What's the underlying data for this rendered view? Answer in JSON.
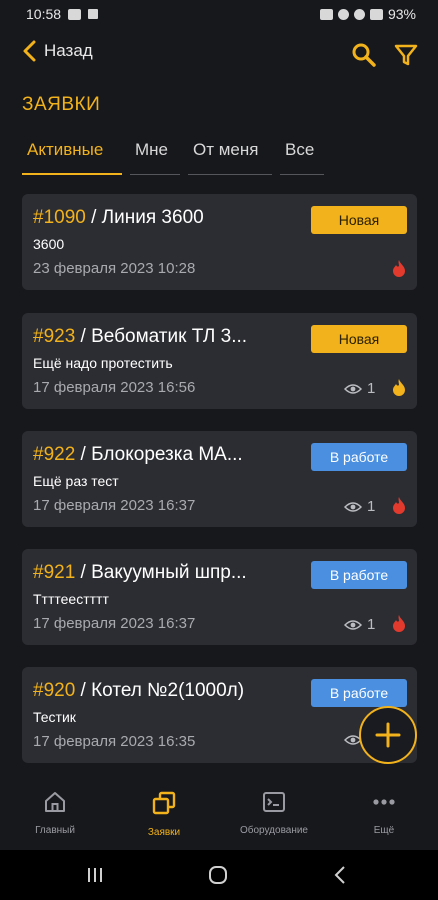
{
  "status_bar": {
    "time": "10:58",
    "battery": "93%"
  },
  "header": {
    "back_label": "Назад",
    "title": "ЗАЯВКИ"
  },
  "tabs": [
    {
      "label": "Активные",
      "active": true
    },
    {
      "label": "Мне",
      "active": false
    },
    {
      "label": "От меня",
      "active": false
    },
    {
      "label": "Все",
      "active": false
    }
  ],
  "requests": [
    {
      "number": "#1090",
      "title": " / Линия 3600",
      "subtitle": "3600",
      "date": "23 февраля 2023 10:28",
      "status": "Новая",
      "status_type": "new",
      "views": "",
      "priority": "high"
    },
    {
      "number": "#923",
      "title": " / Вебоматик ТЛ 3...",
      "subtitle": "Ещё надо протестить",
      "date": "17 февраля 2023 16:56",
      "status": "Новая",
      "status_type": "new",
      "views": "1",
      "priority": "medium"
    },
    {
      "number": "#922",
      "title": " / Блокорезка МА...",
      "subtitle": "Ещё раз тест",
      "date": "17 февраля 2023 16:37",
      "status": "В работе",
      "status_type": "work",
      "views": "1",
      "priority": "high"
    },
    {
      "number": "#921",
      "title": " / Вакуумный шпр...",
      "subtitle": "Ттттеестттт",
      "date": "17 февраля 2023 16:37",
      "status": "В работе",
      "status_type": "work",
      "views": "1",
      "priority": "high"
    },
    {
      "number": "#920",
      "title": " / Котел №2(1000л)",
      "subtitle": "Тестик",
      "date": "17 февраля 2023 16:35",
      "status": "В работе",
      "status_type": "work",
      "views": "",
      "priority": ""
    }
  ],
  "bottom_nav": [
    {
      "label": "Главный",
      "icon": "home-icon",
      "active": false
    },
    {
      "label": "Заявки",
      "icon": "copy-icon",
      "active": true
    },
    {
      "label": "Оборудование",
      "icon": "terminal-icon",
      "active": false
    },
    {
      "label": "Ещё",
      "icon": "more-icon",
      "active": false
    }
  ],
  "colors": {
    "accent": "#f2b21b",
    "background": "#17181c",
    "card": "#2c2d33",
    "status_work": "#4a8fe0",
    "priority_high": "#e23b2e",
    "priority_medium": "#f2b21b"
  }
}
